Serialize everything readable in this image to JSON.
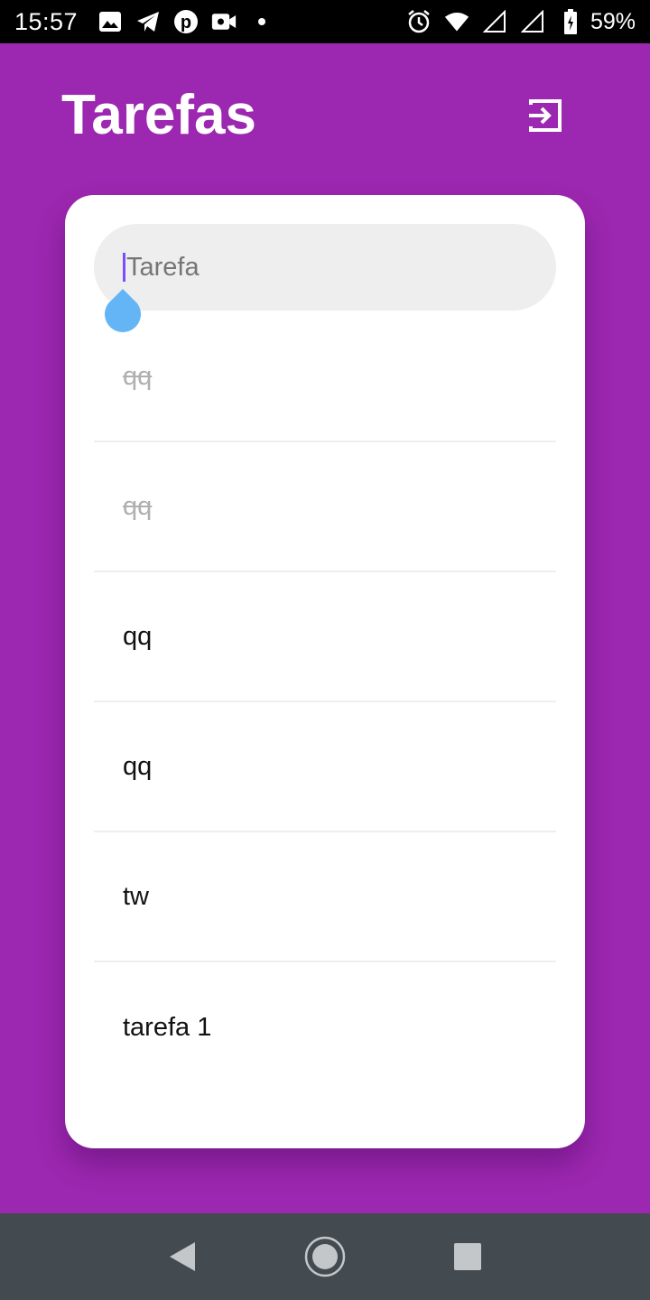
{
  "status_bar": {
    "time": "15:57",
    "battery": "59%",
    "icons": [
      "image-icon",
      "telegram-icon",
      "pinterest-icon",
      "video-icon",
      "dot-icon",
      "alarm-icon",
      "wifi-icon",
      "signal-icon",
      "signal-icon",
      "battery-icon"
    ]
  },
  "header": {
    "title": "Tarefas",
    "logout_icon": "logout-icon"
  },
  "task_input": {
    "placeholder": "Tarefa"
  },
  "tasks": [
    {
      "text": "qq",
      "done": true
    },
    {
      "text": "qq",
      "done": true
    },
    {
      "text": "qq",
      "done": false
    },
    {
      "text": "qq",
      "done": false
    },
    {
      "text": "tw",
      "done": false
    },
    {
      "text": "tarefa 1",
      "done": false
    }
  ],
  "nav": {
    "back": "back-icon",
    "home": "home-icon",
    "recents": "recents-icon"
  },
  "colors": {
    "background": "#9c27b0",
    "card": "#ffffff",
    "input_bg": "#eeeeee",
    "cursor": "#7c4dff",
    "handle": "#64b5f6",
    "nav_bar": "#434a50"
  }
}
